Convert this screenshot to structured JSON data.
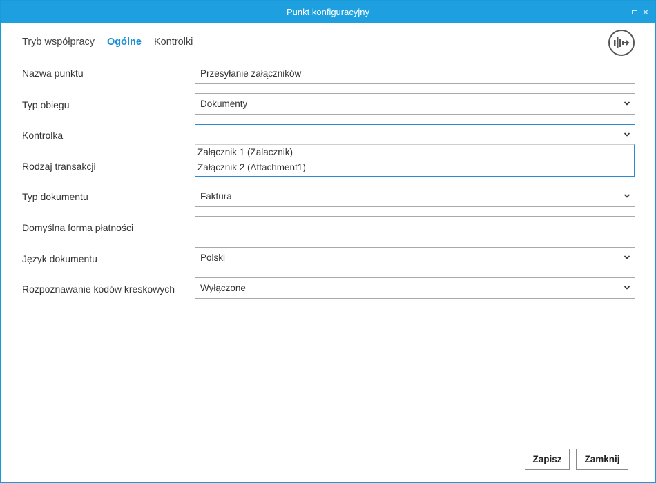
{
  "window": {
    "title": "Punkt konfiguracyjny"
  },
  "tabs": [
    {
      "label": "Tryb współpracy",
      "active": false
    },
    {
      "label": "Ogólne",
      "active": true
    },
    {
      "label": "Kontrolki",
      "active": false
    }
  ],
  "form": {
    "nazwa_punktu": {
      "label": "Nazwa punktu",
      "value": "Przesyłanie załączników"
    },
    "typ_obiegu": {
      "label": "Typ obiegu",
      "value": "Dokumenty"
    },
    "kontrolka": {
      "label": "Kontrolka",
      "value": "",
      "options": [
        "Załącznik 1 (Zalacznik)",
        "Załącznik 2 (Attachment1)"
      ]
    },
    "rodzaj_transakcji": {
      "label": "Rodzaj transakcji"
    },
    "typ_dokumentu": {
      "label": "Typ dokumentu",
      "value": "Faktura"
    },
    "forma_platnosci": {
      "label": "Domyślna forma płatności",
      "value": ""
    },
    "jezyk_dokumentu": {
      "label": "Język dokumentu",
      "value": "Polski"
    },
    "kody_kreskowe": {
      "label": "Rozpoznawanie kodów kreskowych",
      "value": "Wyłączone"
    }
  },
  "buttons": {
    "save": "Zapisz",
    "close": "Zamknij"
  },
  "colors": {
    "titlebar": "#1ea0e0",
    "accent": "#1a8fd6",
    "focus_border": "#2a8ad4"
  }
}
